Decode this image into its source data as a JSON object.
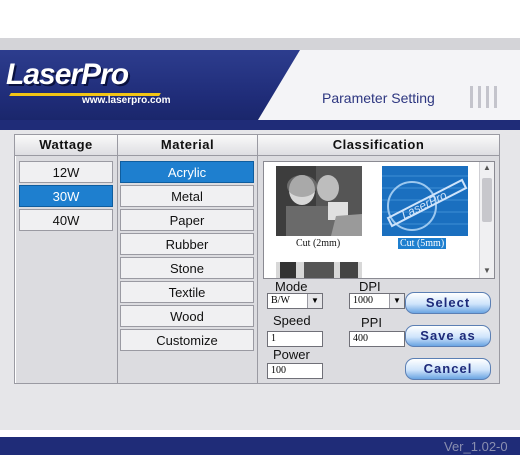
{
  "brand": {
    "logo_text": "LaserPro",
    "logo_url": "www.laserpro.com"
  },
  "header": {
    "title": "Parameter Setting"
  },
  "columns": {
    "wattage": "Wattage",
    "material": "Material",
    "classification": "Classification"
  },
  "wattage_options": [
    {
      "label": "12W",
      "selected": false
    },
    {
      "label": "30W",
      "selected": true
    },
    {
      "label": "40W",
      "selected": false
    }
  ],
  "material_options": [
    {
      "label": "Acrylic",
      "selected": true
    },
    {
      "label": "Metal",
      "selected": false
    },
    {
      "label": "Paper",
      "selected": false
    },
    {
      "label": "Rubber",
      "selected": false
    },
    {
      "label": "Stone",
      "selected": false
    },
    {
      "label": "Textile",
      "selected": false
    },
    {
      "label": "Wood",
      "selected": false
    },
    {
      "label": "Customize",
      "selected": false
    }
  ],
  "classification_items": [
    {
      "label": "Cut (2mm)",
      "selected": false
    },
    {
      "label": "Cut (5mm)",
      "selected": true
    }
  ],
  "settings": {
    "mode_label": "Mode",
    "mode_value": "B/W",
    "dpi_label": "DPI",
    "dpi_value": "1000",
    "speed_label": "Speed",
    "speed_value": "1",
    "ppi_label": "PPI",
    "ppi_value": "400",
    "power_label": "Power",
    "power_value": "100"
  },
  "actions": {
    "select": "Select",
    "save_as": "Save as",
    "cancel": "Cancel"
  },
  "version": "Ver_1.02-0",
  "colors": {
    "brand_blue": "#1f2c78",
    "selected_blue": "#1e7fcf",
    "logo_accent": "#f2c515"
  }
}
